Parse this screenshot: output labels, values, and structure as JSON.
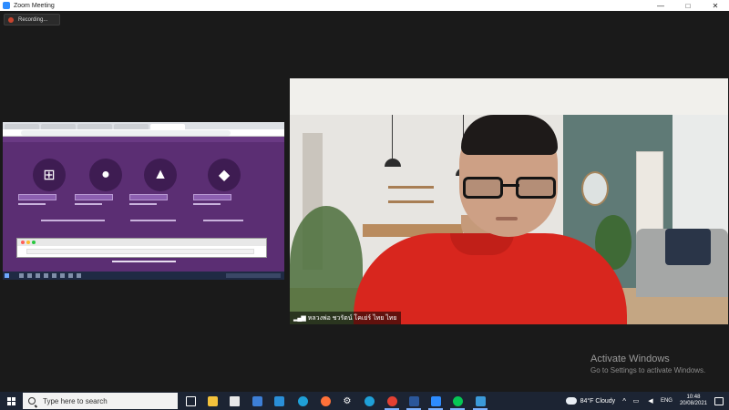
{
  "window": {
    "title": "Zoom Meeting",
    "controls": {
      "minimize": "—",
      "maximize": "□",
      "close": "✕"
    }
  },
  "recording": {
    "label": "Recording..."
  },
  "participant": {
    "name": "หลวงพ่อ ชวรัตน์ โคเย่ร์ ไทย ไทย"
  },
  "watermark": {
    "title": "Activate Windows",
    "subtitle": "Go to Settings to activate Windows."
  },
  "taskbar": {
    "search_placeholder": "Type here to search",
    "weather": "84°F Cloudy",
    "chevron": "^",
    "language": "ENG",
    "time": "10:48",
    "date": "20/08/2021",
    "colors": {
      "zoom": "#2d8cff",
      "chrome": "#e34133",
      "firefox": "#ff7139",
      "edge": "#1fa0d8",
      "word": "#2b579a",
      "line": "#06c755"
    }
  }
}
